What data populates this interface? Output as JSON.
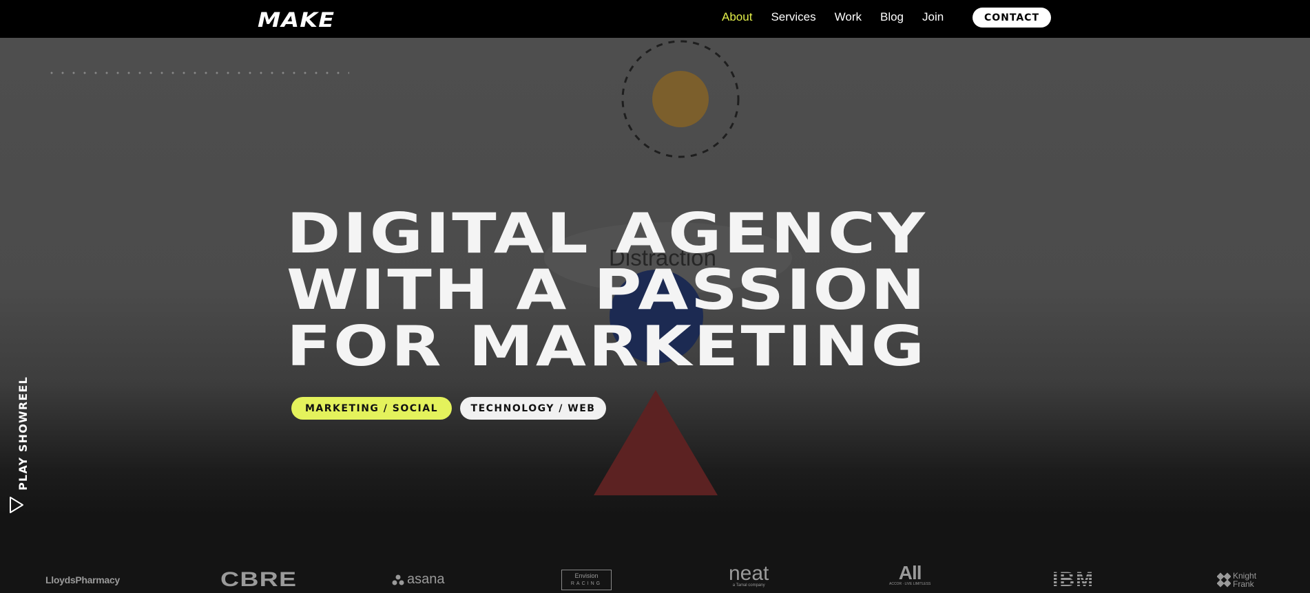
{
  "nav": {
    "logo": "MAKE",
    "links": [
      {
        "label": "About",
        "active": true
      },
      {
        "label": "Services"
      },
      {
        "label": "Work"
      },
      {
        "label": "Blog"
      },
      {
        "label": "Join"
      }
    ],
    "contact_label": "CONTACT"
  },
  "hero": {
    "headline": [
      "DIGITAL AGENCY",
      "WITH A PASSION",
      "FOR MARKETING"
    ],
    "background_caption": "Distraction",
    "tags": [
      {
        "label": "MARKETING / SOCIAL",
        "color": "#e4f25c"
      },
      {
        "label": "TECHNOLOGY / WEB",
        "color": "#f1f1f1"
      }
    ],
    "showreel_label": "PLAY SHOWREEL"
  },
  "clients": [
    {
      "name": "LloydsPharmacy"
    },
    {
      "name": "CBRE"
    },
    {
      "name": "asana"
    },
    {
      "name": "Envision",
      "sub": "RACING"
    },
    {
      "name": "neat",
      "sub": "a Tamal company"
    },
    {
      "name": "All",
      "sub": "ACCOR · LIVE LIMITLESS"
    },
    {
      "name": "IBM"
    },
    {
      "name_line1": "Knight",
      "name_line2": "Frank"
    }
  ],
  "colors": {
    "accent": "#e4f25c",
    "nav_bg": "#000000",
    "hero_bg": "#4e4e4e"
  }
}
